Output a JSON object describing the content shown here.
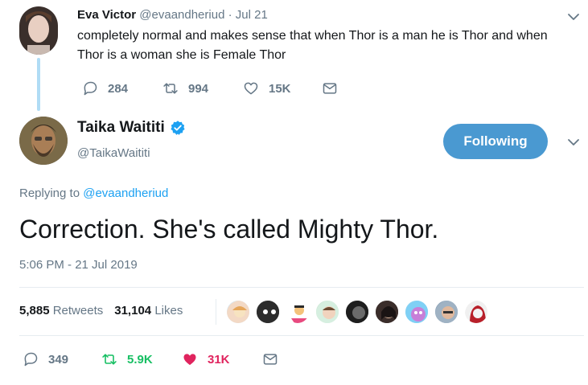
{
  "parent": {
    "name": "Eva Victor",
    "handle": "@evaandheriud",
    "sep": "·",
    "date": "Jul 21",
    "text": "completely normal and makes sense that when Thor is a man he is Thor and when Thor is a woman she is Female Thor",
    "replies": "284",
    "retweets": "994",
    "likes": "15K"
  },
  "tweet": {
    "name": "Taika Waititi",
    "handle": "@TaikaWaititi",
    "follow_label": "Following",
    "replying_prefix": "Replying to",
    "replying_handle": "@evaandheriud",
    "text": "Correction. She's called Mighty Thor.",
    "timestamp": "5:06 PM - 21 Jul 2019",
    "retweets_count": "5,885",
    "retweets_label": "Retweets",
    "likes_count": "31,104",
    "likes_label": "Likes",
    "replies": "349",
    "retweets": "5.9K",
    "likes": "31K"
  },
  "colors": {
    "accent": "#1da1f2",
    "follow_bg": "#4a99d1",
    "retweet_active": "#17bf63",
    "like_active": "#e0245e",
    "muted": "#657786"
  },
  "icons": {
    "reply": "reply-icon",
    "retweet": "retweet-icon",
    "like": "heart-icon",
    "dm": "envelope-icon",
    "verified": "verified-badge-icon",
    "caret": "chevron-down-icon"
  }
}
